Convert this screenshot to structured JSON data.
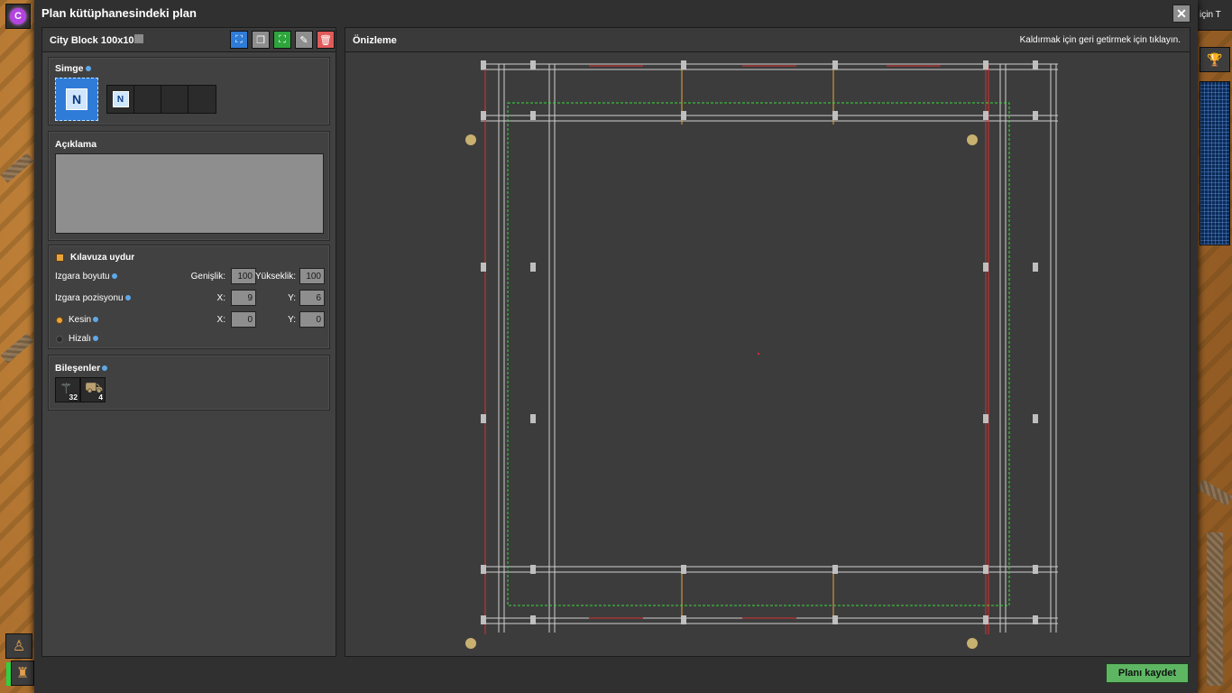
{
  "window": {
    "title": "Plan kütüphanesindeki plan",
    "close_icon": "close-icon"
  },
  "left_toolbar": {
    "mod_label": "C"
  },
  "right_panel": {
    "top_text": "için T"
  },
  "blueprint": {
    "name": "City Block 100x100",
    "toolbar_buttons": [
      {
        "name": "select-icon",
        "color": "#2e7cd8"
      },
      {
        "name": "copy-icon",
        "color": "#8e8e8e"
      },
      {
        "name": "select-green-icon",
        "color": "#2ea43c"
      },
      {
        "name": "pipette-icon",
        "color": "#8e8e8e"
      },
      {
        "name": "delete-icon",
        "color": "#e05a5a"
      }
    ]
  },
  "icons_section": {
    "title": "Simge",
    "main_icon_letter": "N",
    "slot_icon_letter": "N"
  },
  "description_section": {
    "title": "Açıklama",
    "value": ""
  },
  "grid_section": {
    "snap_label": "Kılavuza uydur",
    "snap_checked": true,
    "grid_size_label": "Izgara boyutu",
    "width_label": "Genişlik:",
    "width_value": "100",
    "height_label": "Yükseklik:",
    "height_value": "100",
    "grid_position_label": "Izgara pozisyonu",
    "pos_x_label": "X:",
    "pos_x_value": "9",
    "pos_y_label": "Y:",
    "pos_y_value": "6",
    "absolute_label": "Kesin",
    "absolute_selected": true,
    "abs_x_label": "X:",
    "abs_x_value": "0",
    "abs_y_label": "Y:",
    "abs_y_value": "0",
    "relative_label": "Hizalı"
  },
  "components_section": {
    "title": "Bileşenler",
    "items": [
      {
        "icon": "power-pole-icon",
        "count": "32"
      },
      {
        "icon": "rail-signal-icon",
        "count": "4"
      }
    ]
  },
  "preview": {
    "title": "Önizleme",
    "hint": "Kaldırmak için  geri getirmek için  tıklayın."
  },
  "footer": {
    "save_label": "Planı kaydet"
  },
  "colors": {
    "accent_orange": "#e8a43c",
    "save_green": "#5eb663",
    "rail_red": "#d83030",
    "grid_green": "#3cd83c"
  }
}
